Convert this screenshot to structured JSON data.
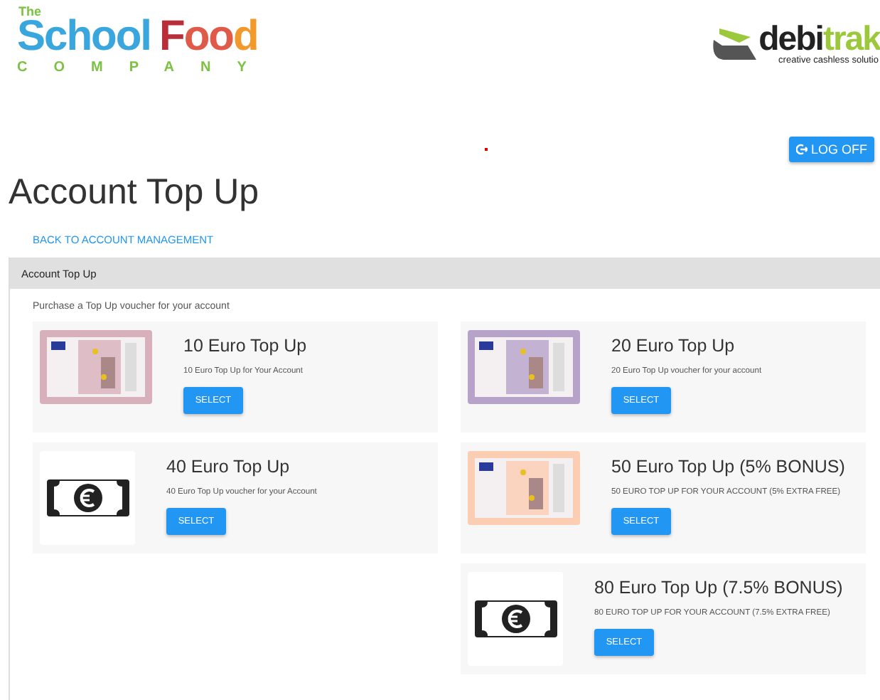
{
  "header": {
    "brand_left": {
      "small": "The",
      "word_1": "School",
      "word_2": "F",
      "word_3": "oo",
      "word_4": "d",
      "sub": "COMPANY"
    },
    "brand_right": {
      "word_1": "debi",
      "word_2": "trak",
      "tagline": "creative cashless solutio"
    }
  },
  "log_off": "LOG OFF",
  "title": "Account Top Up",
  "back_link": "BACK TO ACCOUNT MANAGEMENT",
  "panel": {
    "heading": "Account Top Up",
    "intro": "Purchase a Top Up voucher for your account",
    "columns": [
      [
        {
          "kind": "note",
          "color": "#d8b0bc",
          "title": "10 Euro Top Up",
          "description": "10 Euro Top Up for Your Account",
          "button": "SELECT"
        },
        {
          "kind": "cash",
          "title": "40 Euro Top Up",
          "description": "40 Euro Top Up voucher for your Account",
          "button": "SELECT"
        }
      ],
      [
        {
          "kind": "note",
          "color": "#b7a3c9",
          "title": "20 Euro Top Up",
          "description": "20 Euro Top Up voucher for your account",
          "button": "SELECT"
        },
        {
          "kind": "note",
          "color": "#fbcdb2",
          "title": "50 Euro Top Up (5% BONUS)",
          "description": "50 EURO TOP UP FOR YOUR ACCOUNT (5% EXTRA FREE)",
          "button": "SELECT"
        },
        {
          "kind": "cash",
          "title": "80 Euro Top Up (7.5% BONUS)",
          "description": "80 EURO TOP UP FOR YOUR ACCOUNT (7.5% EXTRA FREE)",
          "button": "SELECT"
        }
      ]
    ]
  }
}
